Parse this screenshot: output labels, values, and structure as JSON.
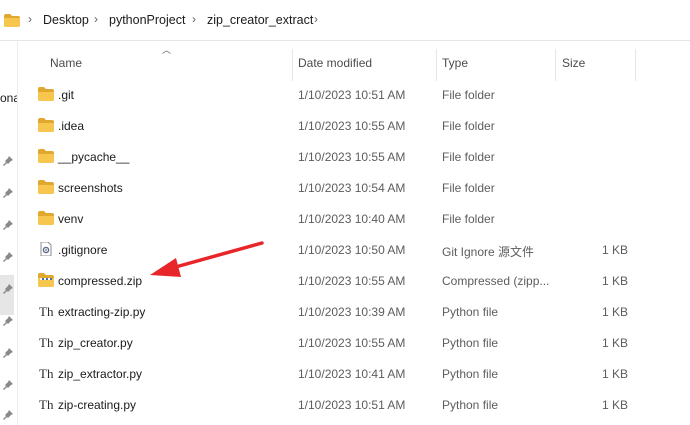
{
  "breadcrumb": {
    "items": [
      "Desktop",
      "pythonProject",
      "zip_creator_extract"
    ]
  },
  "left_pane": {
    "truncated_label": "ona"
  },
  "columns": {
    "name": "Name",
    "date_modified": "Date modified",
    "type": "Type",
    "size": "Size"
  },
  "files": [
    {
      "name": ".git",
      "date": "1/10/2023 10:51 AM",
      "type": "File folder",
      "size": "",
      "icon": "folder-icon"
    },
    {
      "name": ".idea",
      "date": "1/10/2023 10:55 AM",
      "type": "File folder",
      "size": "",
      "icon": "folder-icon"
    },
    {
      "name": "__pycache__",
      "date": "1/10/2023 10:55 AM",
      "type": "File folder",
      "size": "",
      "icon": "folder-icon"
    },
    {
      "name": "screenshots",
      "date": "1/10/2023 10:54 AM",
      "type": "File folder",
      "size": "",
      "icon": "folder-icon"
    },
    {
      "name": "venv",
      "date": "1/10/2023 10:40 AM",
      "type": "File folder",
      "size": "",
      "icon": "folder-icon"
    },
    {
      "name": ".gitignore",
      "date": "1/10/2023 10:50 AM",
      "type": "Git Ignore 源文件",
      "size": "1 KB",
      "icon": "config-file-icon"
    },
    {
      "name": "compressed.zip",
      "date": "1/10/2023 10:55 AM",
      "type": "Compressed (zipp...",
      "size": "1 KB",
      "icon": "zip-folder-icon"
    },
    {
      "name": "extracting-zip.py",
      "date": "1/10/2023 10:39 AM",
      "type": "Python file",
      "size": "1 KB",
      "icon": "python-file-icon"
    },
    {
      "name": "zip_creator.py",
      "date": "1/10/2023 10:55 AM",
      "type": "Python file",
      "size": "1 KB",
      "icon": "python-file-icon"
    },
    {
      "name": "zip_extractor.py",
      "date": "1/10/2023 10:41 AM",
      "type": "Python file",
      "size": "1 KB",
      "icon": "python-file-icon"
    },
    {
      "name": "zip-creating.py",
      "date": "1/10/2023 10:51 AM",
      "type": "Python file",
      "size": "1 KB",
      "icon": "python-file-icon"
    }
  ],
  "annotation": {
    "arrow_color": "#e8262a"
  },
  "colors": {
    "folder": "#f2c04a",
    "folder_dark": "#e0a82e"
  }
}
